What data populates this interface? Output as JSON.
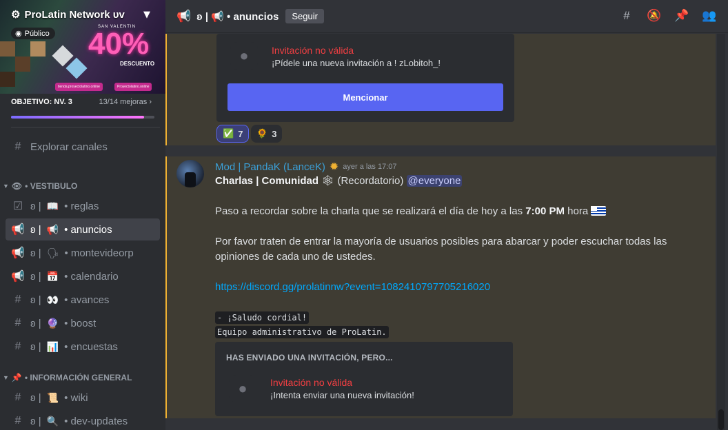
{
  "server": {
    "name": "ProLatin Network ᴜᴠ",
    "public_label": "Público",
    "promo_sub": "SAN VALENTIN",
    "promo_big": "40%",
    "promo_desc": "DESCUENTO",
    "promo_link1": "tienda.proyectolatino.online",
    "promo_link2": "Proyectolatino.online",
    "goal_label": "OBJETIVO: NV. 3",
    "goal_count": "13/14 mejoras",
    "goal_progress": 0.93
  },
  "sidebar": {
    "explore": "Explorar canales",
    "categories": [
      {
        "label": "• VESTIBULO",
        "emoji": "👁"
      },
      {
        "label": "• INFORMACIÓN GENERAL",
        "emoji": "📌"
      }
    ],
    "channels": [
      {
        "prefix": "ʚ |",
        "emoji": "📖",
        "name": "• reglas"
      },
      {
        "prefix": "ʚ |",
        "emoji": "📢",
        "name": "• anuncios"
      },
      {
        "prefix": "ʚ |",
        "emoji": "🗣",
        "name": "• montevideorp"
      },
      {
        "prefix": "ʚ |",
        "emoji": "📅",
        "name": "• calendario"
      },
      {
        "prefix": "ʚ |",
        "emoji": "👀",
        "name": "• avances"
      },
      {
        "prefix": "ʚ |",
        "emoji": "🔮",
        "name": "• boost"
      },
      {
        "prefix": "ʚ |",
        "emoji": "📊",
        "name": "• encuestas"
      },
      {
        "prefix": "ʚ |",
        "emoji": "📜",
        "name": "• wiki"
      },
      {
        "prefix": "ʚ |",
        "emoji": "🔍",
        "name": "• dev-updates"
      }
    ]
  },
  "header": {
    "channel": "ʚ | 📢 • anuncios",
    "follow_label": "Seguir"
  },
  "messages": {
    "invite1_title": "Invitación no válida",
    "invite1_sub": "¡Pídele una nueva invitación a ! zLobitoh_!",
    "mention_label": "Mencionar",
    "reactions": [
      {
        "emoji": "✅",
        "count": "7"
      },
      {
        "emoji": "🌻",
        "count": "3"
      }
    ],
    "author": "Mod | PandaK (LanceK)",
    "timestamp": "ayer a las 17:07",
    "line1_bold": "Charlas | Comunidad",
    "line1_rest": "(Recordatorio)",
    "line1_mention": "@everyone",
    "line2_pre": "Paso a recordar sobre la charla que se realizará el día de hoy a las ",
    "line2_bold": "7:00 PM",
    "line2_post": " hora",
    "line3a": "Por favor traten de entrar la mayoría de usuarios posibles para abarcar y poder escuchar todas las",
    "line3b": "opiniones de cada uno de ustedes.",
    "link": "https://discord.gg/prolatinnw?event=1082410797705216020",
    "code1": "- ¡Saludo cordial!",
    "code2": "Equipo administrativo de ProLatin.",
    "invite2_header": "HAS ENVIADO UNA INVITACIÓN, PERO...",
    "invite2_title": "Invitación no válida",
    "invite2_sub": "¡Intenta enviar una nueva invitación!"
  }
}
